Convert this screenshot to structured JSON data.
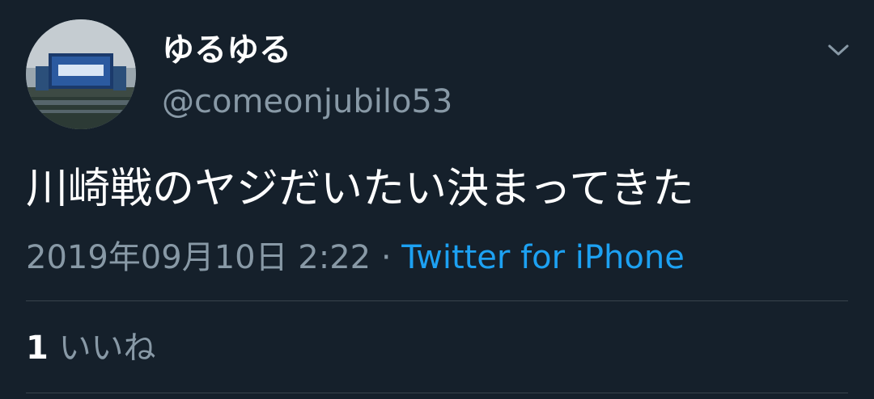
{
  "user": {
    "display_name": "ゆるゆる",
    "handle": "@comeonjubilo53"
  },
  "tweet": {
    "text": "川崎戦のヤジだいたい決まってきた",
    "timestamp": "2019年09月10日 2:22",
    "separator": "·",
    "source": "Twitter for iPhone"
  },
  "stats": {
    "likes_count": "1",
    "likes_label": "いいね"
  },
  "icons": {
    "more": "chevron-down-icon",
    "avatar": "avatar"
  },
  "colors": {
    "background": "#15202b",
    "primary_text": "#ffffff",
    "secondary_text": "#8899a6",
    "link": "#1da1f2",
    "divider": "#38444d"
  }
}
